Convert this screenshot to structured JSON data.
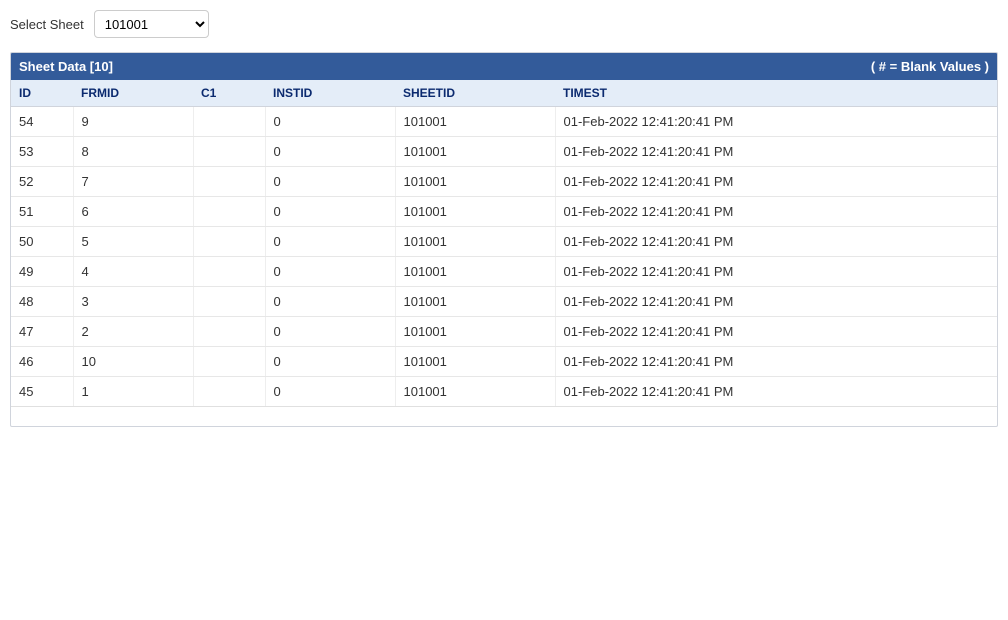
{
  "selector": {
    "label": "Select Sheet",
    "selected": "101001"
  },
  "panel": {
    "title": "Sheet Data [10]",
    "note": "( # = Blank Values )"
  },
  "columns": {
    "id": "ID",
    "frmid": "FRMID",
    "c1": "C1",
    "instid": "INSTID",
    "sheetid": "SHEETID",
    "timest": "TIMEST"
  },
  "rows": [
    {
      "id": "54",
      "frmid": "9",
      "c1": "",
      "instid": "0",
      "sheetid": "101001",
      "timest": "01-Feb-2022 12:41:20:41 PM"
    },
    {
      "id": "53",
      "frmid": "8",
      "c1": "",
      "instid": "0",
      "sheetid": "101001",
      "timest": "01-Feb-2022 12:41:20:41 PM"
    },
    {
      "id": "52",
      "frmid": "7",
      "c1": "",
      "instid": "0",
      "sheetid": "101001",
      "timest": "01-Feb-2022 12:41:20:41 PM"
    },
    {
      "id": "51",
      "frmid": "6",
      "c1": "",
      "instid": "0",
      "sheetid": "101001",
      "timest": "01-Feb-2022 12:41:20:41 PM"
    },
    {
      "id": "50",
      "frmid": "5",
      "c1": "",
      "instid": "0",
      "sheetid": "101001",
      "timest": "01-Feb-2022 12:41:20:41 PM"
    },
    {
      "id": "49",
      "frmid": "4",
      "c1": "",
      "instid": "0",
      "sheetid": "101001",
      "timest": "01-Feb-2022 12:41:20:41 PM"
    },
    {
      "id": "48",
      "frmid": "3",
      "c1": "",
      "instid": "0",
      "sheetid": "101001",
      "timest": "01-Feb-2022 12:41:20:41 PM"
    },
    {
      "id": "47",
      "frmid": "2",
      "c1": "",
      "instid": "0",
      "sheetid": "101001",
      "timest": "01-Feb-2022 12:41:20:41 PM"
    },
    {
      "id": "46",
      "frmid": "10",
      "c1": "",
      "instid": "0",
      "sheetid": "101001",
      "timest": "01-Feb-2022 12:41:20:41 PM"
    },
    {
      "id": "45",
      "frmid": "1",
      "c1": "",
      "instid": "0",
      "sheetid": "101001",
      "timest": "01-Feb-2022 12:41:20:41 PM"
    }
  ]
}
